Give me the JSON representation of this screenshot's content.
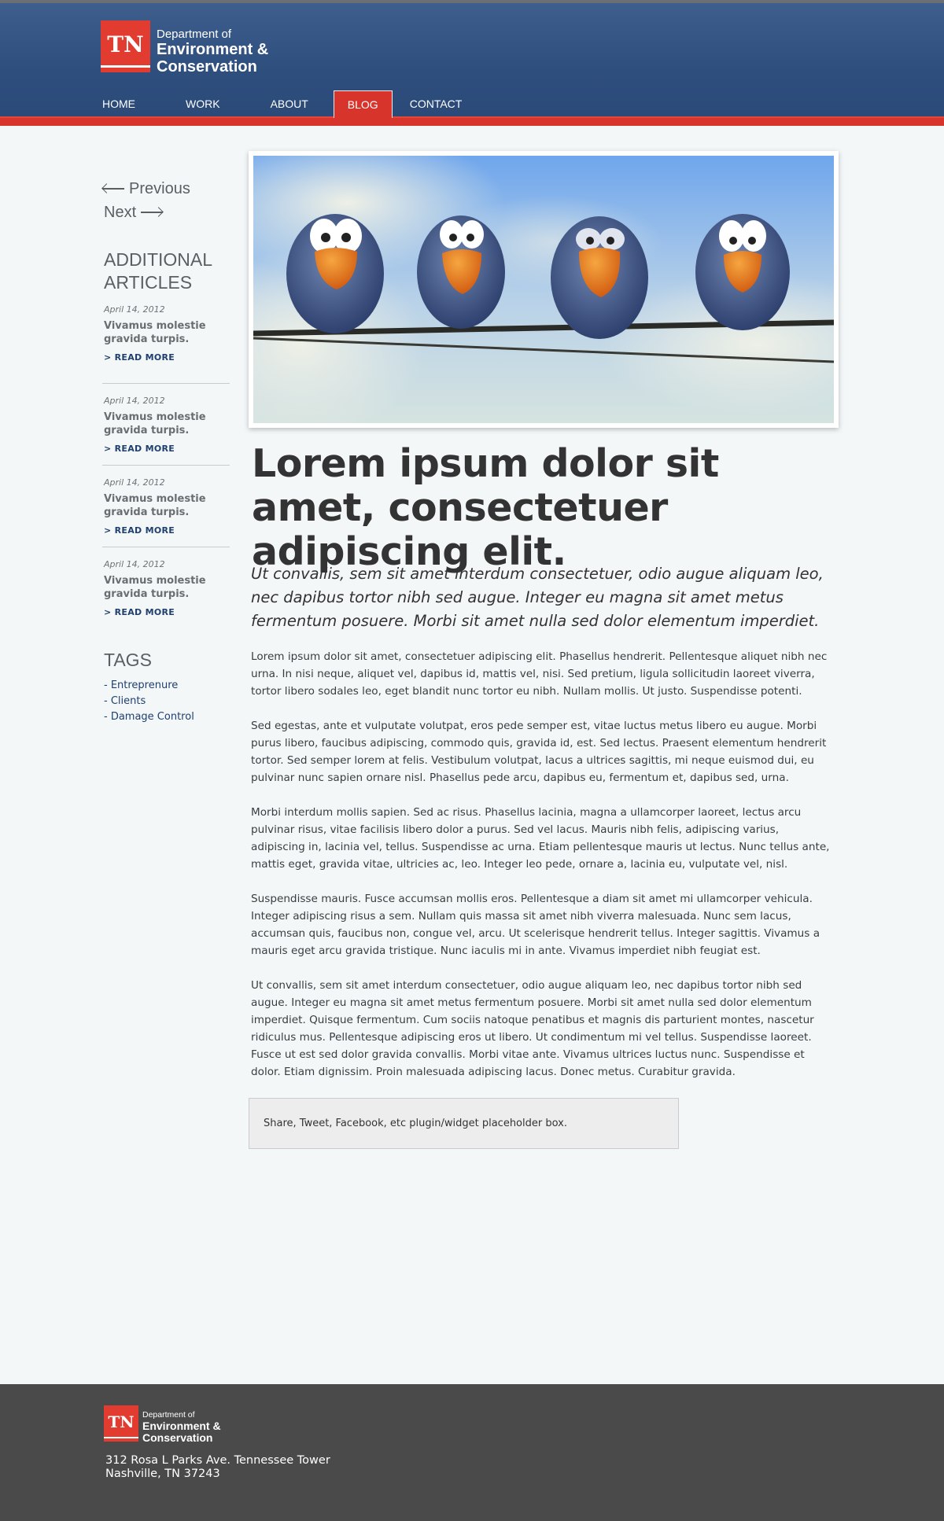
{
  "header": {
    "logo": {
      "badge": "TN",
      "line1": "Department of",
      "line2": "Environment &",
      "line3": "Conservation"
    },
    "nav": [
      {
        "label": "HOME"
      },
      {
        "label": "WORK"
      },
      {
        "label": "ABOUT"
      },
      {
        "label": "BLOG",
        "active": true
      },
      {
        "label": "CONTACT"
      }
    ],
    "colors": {
      "header_blue": "#2e4e7e",
      "accent_red": "#d7352b"
    }
  },
  "sidebar": {
    "previous_label": "Previous",
    "next_label": "Next",
    "additional_title": "ADDITIONAL ARTICLES",
    "articles": [
      {
        "date": "April 14, 2012",
        "title": "Vivamus molestie gravida turpis.",
        "more": "> READ MORE"
      },
      {
        "date": "April 14, 2012",
        "title": "Vivamus molestie gravida turpis.",
        "more": "> READ MORE"
      },
      {
        "date": "April 14, 2012",
        "title": "Vivamus molestie gravida turpis.",
        "more": "> READ MORE"
      },
      {
        "date": "April 14, 2012",
        "title": "Vivamus molestie gravida turpis.",
        "more": "> READ MORE"
      }
    ],
    "tags_title": "TAGS",
    "tags": [
      "- Entreprenure",
      "- Clients",
      "- Damage Control"
    ]
  },
  "main": {
    "hero_image": "four-birds-on-wire-illustration",
    "headline": "Lorem ipsum dolor sit amet, consectetuer adipiscing elit.",
    "lead": "Ut convallis, sem sit amet interdum consectetuer, odio augue aliquam leo, nec dapibus tortor nibh sed augue. Integer eu magna sit amet metus fermentum posuere. Morbi sit amet nulla sed dolor elementum imperdiet.",
    "paragraphs": [
      "Lorem ipsum dolor sit amet, consectetuer adipiscing elit. Phasellus hendrerit. Pellentesque aliquet nibh nec urna. In nisi neque, aliquet vel, dapibus id, mattis vel, nisi. Sed pretium, ligula sollicitudin laoreet viverra, tortor libero sodales leo, eget blandit nunc tortor eu nibh. Nullam mollis. Ut justo. Suspendisse potenti.",
      "Sed egestas, ante et vulputate volutpat, eros pede semper est, vitae luctus metus libero eu augue. Morbi purus libero, faucibus adipiscing, commodo quis, gravida id, est. Sed lectus. Praesent elementum hendrerit tortor. Sed semper lorem at felis. Vestibulum volutpat, lacus a ultrices sagittis, mi neque euismod dui, eu pulvinar nunc sapien ornare nisl. Phasellus pede arcu, dapibus eu, fermentum et, dapibus sed, urna.",
      "Morbi interdum mollis sapien. Sed ac risus. Phasellus lacinia, magna a ullamcorper laoreet, lectus arcu pulvinar risus, vitae facilisis libero dolor a purus. Sed vel lacus. Mauris nibh felis, adipiscing varius, adipiscing in, lacinia vel, tellus. Suspendisse ac urna. Etiam pellentesque mauris ut lectus. Nunc tellus ante, mattis eget, gravida vitae, ultricies ac, leo. Integer leo pede, ornare a, lacinia eu, vulputate vel, nisl.",
      "Suspendisse mauris. Fusce accumsan mollis eros. Pellentesque a diam sit amet mi ullamcorper vehicula. Integer adipiscing risus a sem. Nullam quis massa sit amet nibh viverra malesuada. Nunc sem lacus, accumsan quis, faucibus non, congue vel, arcu. Ut scelerisque hendrerit tellus. Integer sagittis. Vivamus a mauris eget arcu gravida tristique. Nunc iaculis mi in ante. Vivamus imperdiet nibh feugiat est.",
      "Ut convallis, sem sit amet interdum consectetuer, odio augue aliquam leo, nec dapibus tortor nibh sed augue. Integer eu magna sit amet metus fermentum posuere. Morbi sit amet nulla sed dolor elementum imperdiet. Quisque fermentum. Cum sociis natoque penatibus et magnis dis parturient montes, nascetur ridiculus mus. Pellentesque adipiscing eros ut libero. Ut condimentum mi vel tellus. Suspendisse laoreet. Fusce ut est sed dolor gravida convallis. Morbi vitae ante. Vivamus ultrices luctus nunc. Suspendisse et dolor. Etiam dignissim. Proin malesuada adipiscing lacus. Donec metus. Curabitur gravida."
    ],
    "share_text": "Share, Tweet, Facebook, etc plugin/widget placeholder box."
  },
  "footer": {
    "logo": {
      "badge": "TN",
      "line1": "Department of",
      "line2": "Environment &",
      "line3": "Conservation"
    },
    "address_line1": "312 Rosa L Parks Ave. Tennessee Tower",
    "address_line2": "Nashville, TN 37243"
  }
}
